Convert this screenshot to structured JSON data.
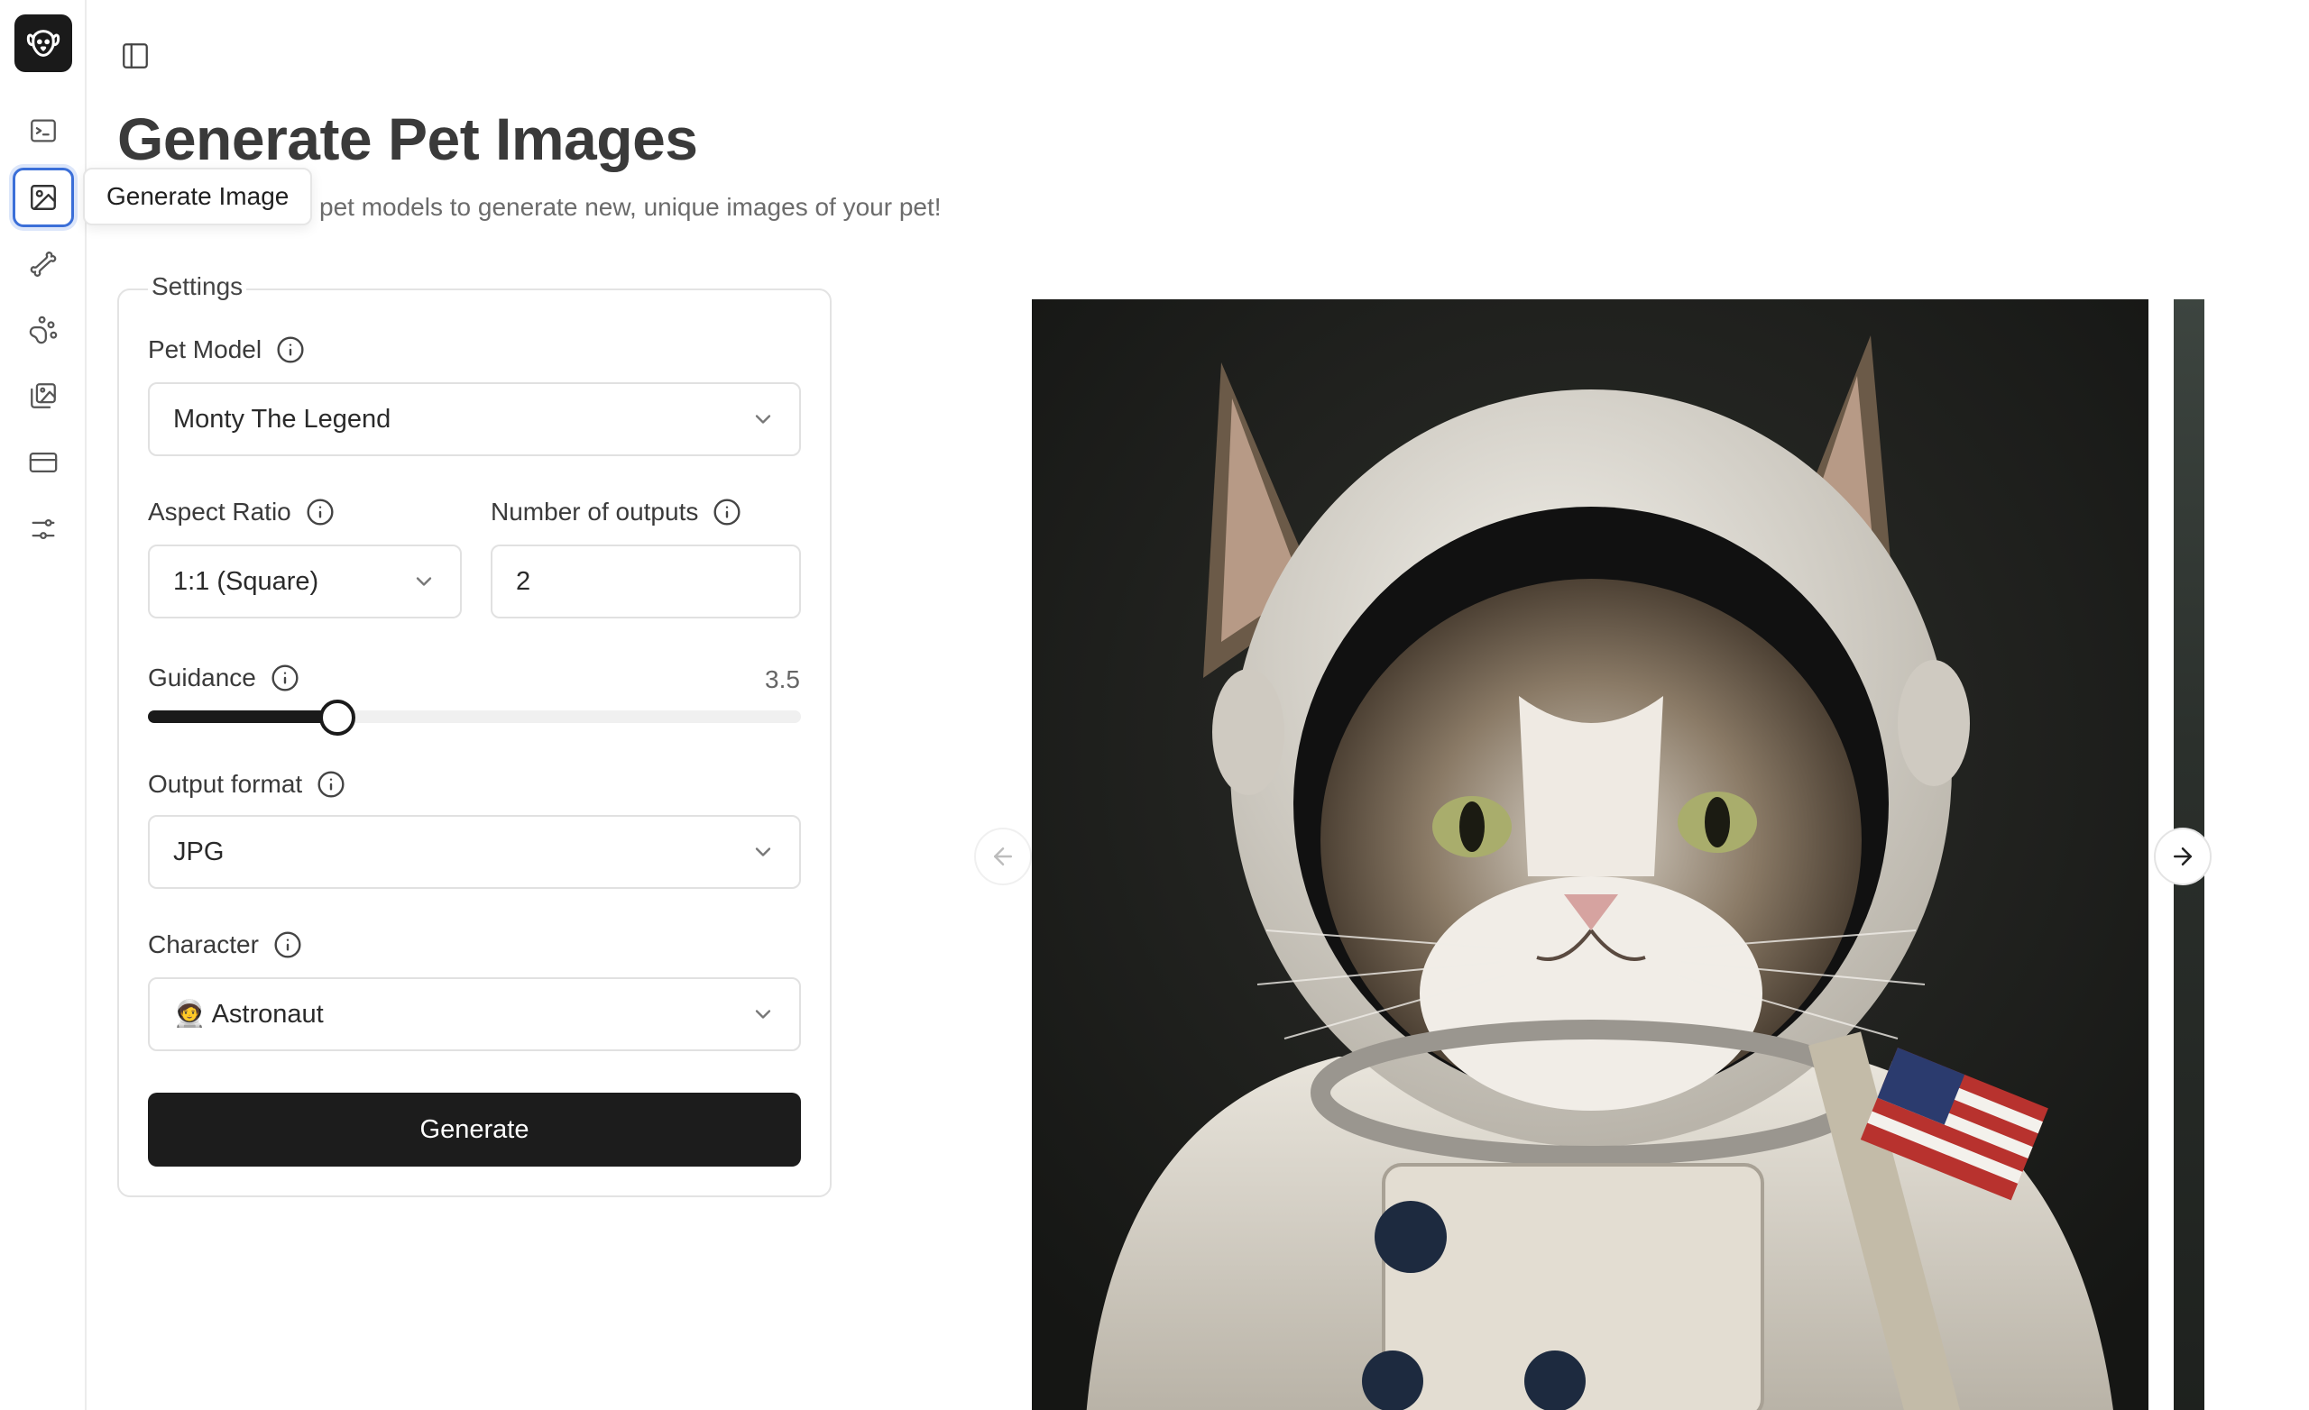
{
  "sidebar": {
    "tooltip": "Generate Image",
    "items": [
      {
        "icon": "terminal-icon"
      },
      {
        "icon": "image-icon",
        "active": true
      },
      {
        "icon": "bone-icon"
      },
      {
        "icon": "paw-icon"
      },
      {
        "icon": "gallery-icon"
      },
      {
        "icon": "credit-card-icon"
      },
      {
        "icon": "settings-sliders-icon"
      }
    ]
  },
  "page": {
    "title": "Generate Pet Images",
    "subtitle": "pet models to generate new, unique images of your pet!"
  },
  "settings": {
    "legend": "Settings",
    "pet_model": {
      "label": "Pet Model",
      "value": "Monty The Legend"
    },
    "aspect_ratio": {
      "label": "Aspect Ratio",
      "value": "1:1 (Square)"
    },
    "num_outputs": {
      "label": "Number of outputs",
      "value": "2"
    },
    "guidance": {
      "label": "Guidance",
      "value": "3.5",
      "fraction": 0.29
    },
    "output_format": {
      "label": "Output format",
      "value": "JPG"
    },
    "character": {
      "label": "Character",
      "value": "🧑‍🚀 Astronaut"
    },
    "generate_label": "Generate"
  },
  "carousel": {
    "image_alt": "Cat in astronaut suit",
    "accent": "#1a1a1a"
  }
}
